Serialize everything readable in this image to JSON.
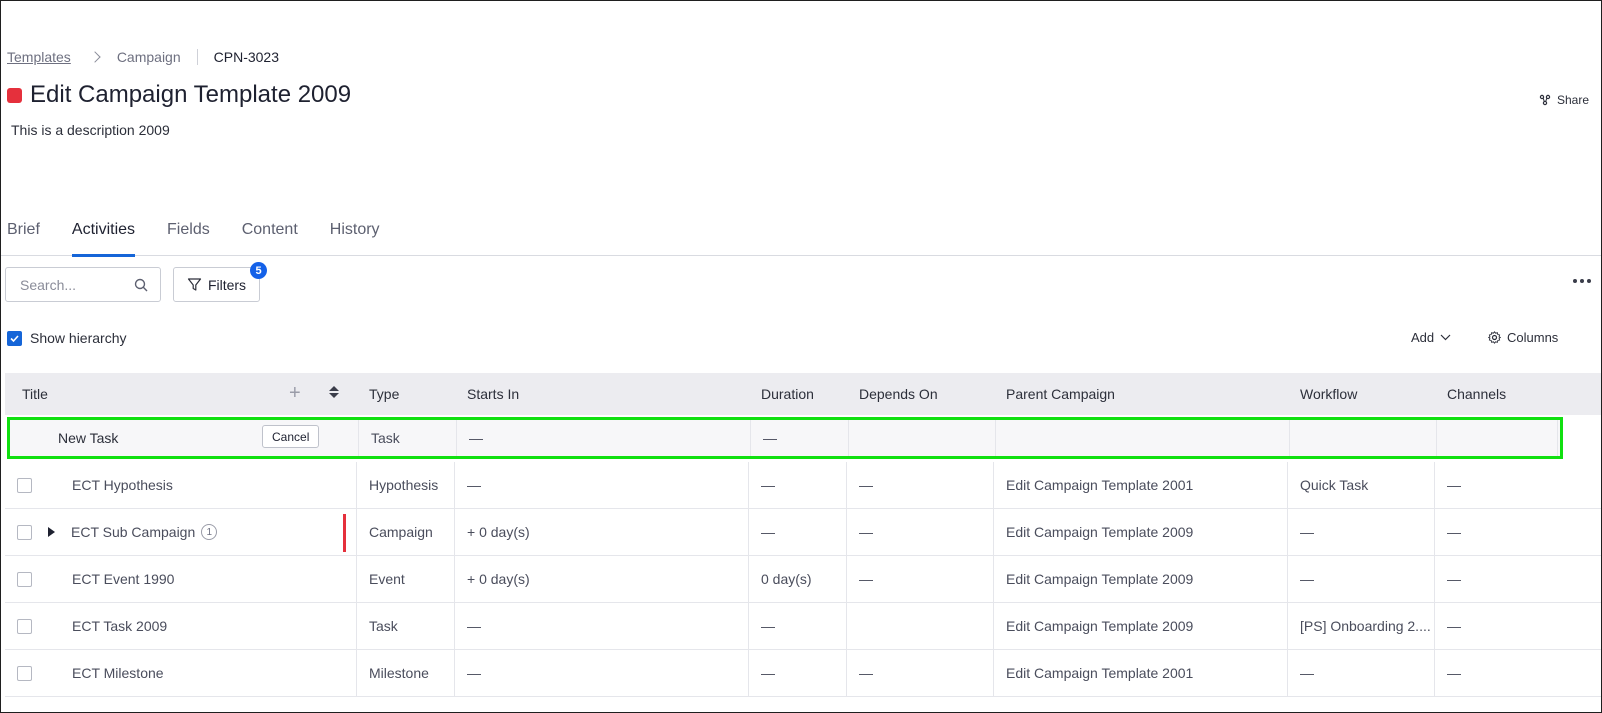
{
  "breadcrumb": {
    "root": "Templates",
    "section": "Campaign",
    "id": "CPN-3023"
  },
  "header": {
    "title": "Edit Campaign Template 2009",
    "description": "This is a description 2009",
    "share_label": "Share",
    "status_color": "#e5303c"
  },
  "tabs": [
    "Brief",
    "Activities",
    "Fields",
    "Content",
    "History"
  ],
  "active_tab": "Activities",
  "toolbar": {
    "search_placeholder": "Search...",
    "filters_label": "Filters",
    "filters_count": "5",
    "show_hierarchy_label": "Show hierarchy",
    "show_hierarchy_checked": true,
    "add_label": "Add",
    "columns_label": "Columns"
  },
  "table": {
    "columns": [
      "Title",
      "Type",
      "Starts In",
      "Duration",
      "Depends On",
      "Parent Campaign",
      "Workflow",
      "Channels"
    ],
    "new_row": {
      "title_value": "New Task",
      "cancel_label": "Cancel",
      "type": "Task",
      "starts_in": "—",
      "duration": "—"
    },
    "rows": [
      {
        "title": "ECT Hypothesis",
        "type": "Hypothesis",
        "starts_in": "—",
        "duration": "—",
        "depends_on": "—",
        "parent": "Edit Campaign Template 2001",
        "workflow": "Quick Task",
        "channels": "—"
      },
      {
        "title": "ECT Sub Campaign",
        "child_count": "1",
        "type": "Campaign",
        "starts_in": "+ 0 day(s)",
        "duration": "—",
        "depends_on": "—",
        "parent": "Edit Campaign Template 2009",
        "workflow": "—",
        "channels": "—"
      },
      {
        "title": "ECT Event 1990",
        "type": "Event",
        "starts_in": "+ 0 day(s)",
        "duration": "0 day(s)",
        "depends_on": "—",
        "parent": "Edit Campaign Template 2009",
        "workflow": "—",
        "channels": "—"
      },
      {
        "title": "ECT Task 2009",
        "type": "Task",
        "starts_in": "—",
        "duration": "—",
        "depends_on": "",
        "parent": "Edit Campaign Template 2009",
        "workflow": "[PS] Onboarding 2....",
        "channels": "—"
      },
      {
        "title": "ECT Milestone",
        "type": "Milestone",
        "starts_in": "—",
        "duration": "—",
        "depends_on": "—",
        "parent": "Edit Campaign Template 2001",
        "workflow": "—",
        "channels": "—"
      }
    ]
  }
}
